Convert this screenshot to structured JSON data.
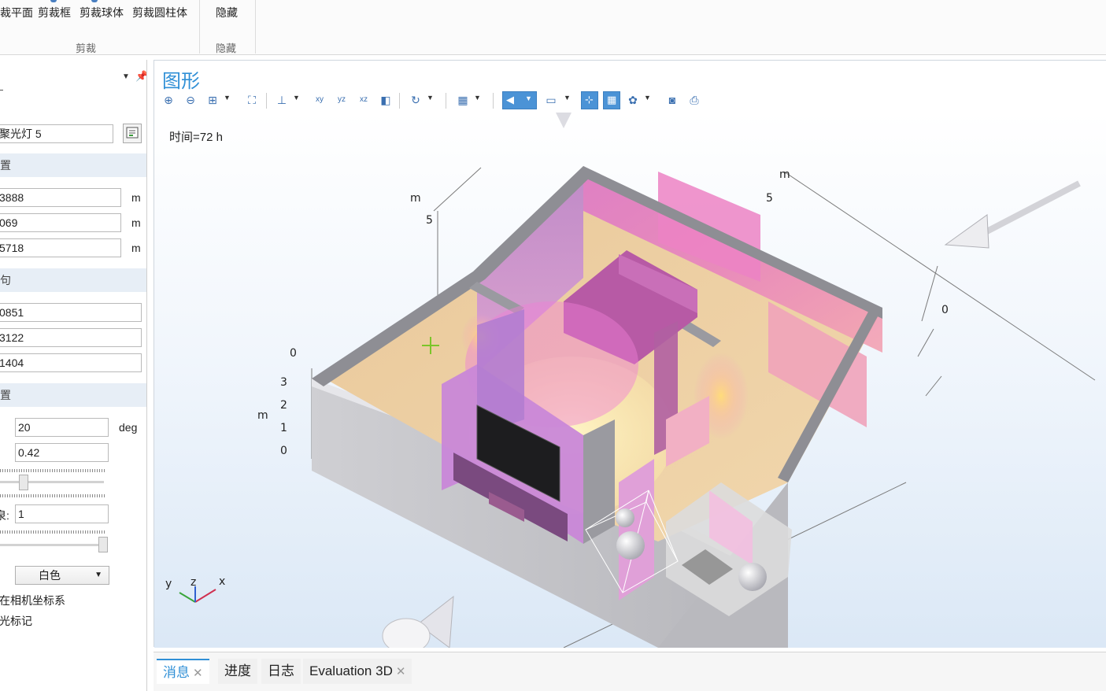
{
  "ribbon": {
    "clip_group": {
      "items": [
        "裁平面",
        "剪裁框",
        "剪裁球体",
        "剪裁圆柱体"
      ],
      "label": "剪裁"
    },
    "hide_group": {
      "items": [
        "隐藏"
      ],
      "label": "隐藏"
    }
  },
  "left_panel": {
    "name_value": "聚光灯 5",
    "section1": "置",
    "position": [
      {
        "value": "3888",
        "unit": "m"
      },
      {
        "value": "069",
        "unit": "m"
      },
      {
        "value": "5718",
        "unit": "m"
      }
    ],
    "section2": "句",
    "direction": [
      "0851",
      "3122",
      "1404"
    ],
    "section3": "置",
    "cone_angle": {
      "value": "20",
      "unit": "deg"
    },
    "intensity": {
      "value": "0.42"
    },
    "slider1_fraction": 0.2,
    "spread_label": "泉:",
    "spread_value": "1",
    "slider2_fraction": 1.0,
    "color_select": "白色",
    "checkbox1": "在相机坐标系",
    "checkbox2": "光标记"
  },
  "graphics": {
    "title": "图形",
    "time_label": "时间=72 h",
    "axis_labels": {
      "m_left": "m",
      "five_left": "5",
      "m_right": "m",
      "five_right": "5",
      "zero_right": "0",
      "zero_left": "0",
      "z_ticks": [
        "3",
        "2",
        "1",
        "0"
      ],
      "z_unit": "m"
    },
    "triad": {
      "x": "x",
      "y": "y",
      "z": "z"
    },
    "toolbar_icons": [
      "zoom-in-icon",
      "zoom-out-icon",
      "zoom-box-icon",
      "zoom-extents-icon",
      "axes-icon",
      "xy-view-icon",
      "yz-view-icon",
      "xz-view-icon",
      "go-to-view-icon",
      "rotate-icon",
      "views-icon",
      "lights-icon",
      "render-icon",
      "grid-icon",
      "scene-light-icon",
      "image-snapshot-icon",
      "print-icon"
    ],
    "colors": {
      "title": "#2f8fd6",
      "accent": "#4b93d6"
    }
  },
  "bottom_tabs": [
    {
      "label": "消息",
      "closable": true,
      "active": true
    },
    {
      "label": "进度",
      "closable": false,
      "active": false
    },
    {
      "label": "日志",
      "closable": false,
      "active": false
    },
    {
      "label": "Evaluation 3D",
      "closable": true,
      "active": false
    }
  ]
}
